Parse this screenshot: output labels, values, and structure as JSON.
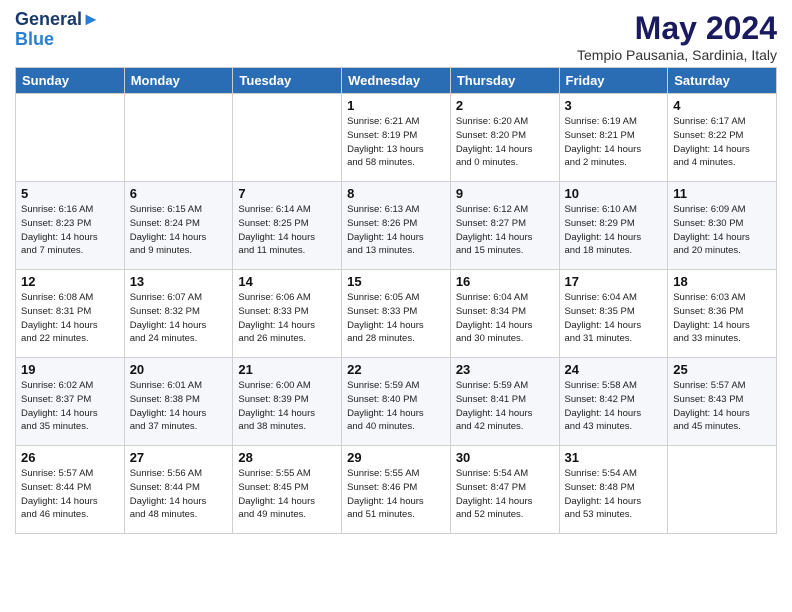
{
  "header": {
    "logo_line1": "General",
    "logo_line2": "Blue",
    "month_title": "May 2024",
    "location": "Tempio Pausania, Sardinia, Italy"
  },
  "weekdays": [
    "Sunday",
    "Monday",
    "Tuesday",
    "Wednesday",
    "Thursday",
    "Friday",
    "Saturday"
  ],
  "rows": [
    [
      {
        "day": "",
        "info": ""
      },
      {
        "day": "",
        "info": ""
      },
      {
        "day": "",
        "info": ""
      },
      {
        "day": "1",
        "info": "Sunrise: 6:21 AM\nSunset: 8:19 PM\nDaylight: 13 hours\nand 58 minutes."
      },
      {
        "day": "2",
        "info": "Sunrise: 6:20 AM\nSunset: 8:20 PM\nDaylight: 14 hours\nand 0 minutes."
      },
      {
        "day": "3",
        "info": "Sunrise: 6:19 AM\nSunset: 8:21 PM\nDaylight: 14 hours\nand 2 minutes."
      },
      {
        "day": "4",
        "info": "Sunrise: 6:17 AM\nSunset: 8:22 PM\nDaylight: 14 hours\nand 4 minutes."
      }
    ],
    [
      {
        "day": "5",
        "info": "Sunrise: 6:16 AM\nSunset: 8:23 PM\nDaylight: 14 hours\nand 7 minutes."
      },
      {
        "day": "6",
        "info": "Sunrise: 6:15 AM\nSunset: 8:24 PM\nDaylight: 14 hours\nand 9 minutes."
      },
      {
        "day": "7",
        "info": "Sunrise: 6:14 AM\nSunset: 8:25 PM\nDaylight: 14 hours\nand 11 minutes."
      },
      {
        "day": "8",
        "info": "Sunrise: 6:13 AM\nSunset: 8:26 PM\nDaylight: 14 hours\nand 13 minutes."
      },
      {
        "day": "9",
        "info": "Sunrise: 6:12 AM\nSunset: 8:27 PM\nDaylight: 14 hours\nand 15 minutes."
      },
      {
        "day": "10",
        "info": "Sunrise: 6:10 AM\nSunset: 8:29 PM\nDaylight: 14 hours\nand 18 minutes."
      },
      {
        "day": "11",
        "info": "Sunrise: 6:09 AM\nSunset: 8:30 PM\nDaylight: 14 hours\nand 20 minutes."
      }
    ],
    [
      {
        "day": "12",
        "info": "Sunrise: 6:08 AM\nSunset: 8:31 PM\nDaylight: 14 hours\nand 22 minutes."
      },
      {
        "day": "13",
        "info": "Sunrise: 6:07 AM\nSunset: 8:32 PM\nDaylight: 14 hours\nand 24 minutes."
      },
      {
        "day": "14",
        "info": "Sunrise: 6:06 AM\nSunset: 8:33 PM\nDaylight: 14 hours\nand 26 minutes."
      },
      {
        "day": "15",
        "info": "Sunrise: 6:05 AM\nSunset: 8:33 PM\nDaylight: 14 hours\nand 28 minutes."
      },
      {
        "day": "16",
        "info": "Sunrise: 6:04 AM\nSunset: 8:34 PM\nDaylight: 14 hours\nand 30 minutes."
      },
      {
        "day": "17",
        "info": "Sunrise: 6:04 AM\nSunset: 8:35 PM\nDaylight: 14 hours\nand 31 minutes."
      },
      {
        "day": "18",
        "info": "Sunrise: 6:03 AM\nSunset: 8:36 PM\nDaylight: 14 hours\nand 33 minutes."
      }
    ],
    [
      {
        "day": "19",
        "info": "Sunrise: 6:02 AM\nSunset: 8:37 PM\nDaylight: 14 hours\nand 35 minutes."
      },
      {
        "day": "20",
        "info": "Sunrise: 6:01 AM\nSunset: 8:38 PM\nDaylight: 14 hours\nand 37 minutes."
      },
      {
        "day": "21",
        "info": "Sunrise: 6:00 AM\nSunset: 8:39 PM\nDaylight: 14 hours\nand 38 minutes."
      },
      {
        "day": "22",
        "info": "Sunrise: 5:59 AM\nSunset: 8:40 PM\nDaylight: 14 hours\nand 40 minutes."
      },
      {
        "day": "23",
        "info": "Sunrise: 5:59 AM\nSunset: 8:41 PM\nDaylight: 14 hours\nand 42 minutes."
      },
      {
        "day": "24",
        "info": "Sunrise: 5:58 AM\nSunset: 8:42 PM\nDaylight: 14 hours\nand 43 minutes."
      },
      {
        "day": "25",
        "info": "Sunrise: 5:57 AM\nSunset: 8:43 PM\nDaylight: 14 hours\nand 45 minutes."
      }
    ],
    [
      {
        "day": "26",
        "info": "Sunrise: 5:57 AM\nSunset: 8:44 PM\nDaylight: 14 hours\nand 46 minutes."
      },
      {
        "day": "27",
        "info": "Sunrise: 5:56 AM\nSunset: 8:44 PM\nDaylight: 14 hours\nand 48 minutes."
      },
      {
        "day": "28",
        "info": "Sunrise: 5:55 AM\nSunset: 8:45 PM\nDaylight: 14 hours\nand 49 minutes."
      },
      {
        "day": "29",
        "info": "Sunrise: 5:55 AM\nSunset: 8:46 PM\nDaylight: 14 hours\nand 51 minutes."
      },
      {
        "day": "30",
        "info": "Sunrise: 5:54 AM\nSunset: 8:47 PM\nDaylight: 14 hours\nand 52 minutes."
      },
      {
        "day": "31",
        "info": "Sunrise: 5:54 AM\nSunset: 8:48 PM\nDaylight: 14 hours\nand 53 minutes."
      },
      {
        "day": "",
        "info": ""
      }
    ]
  ]
}
